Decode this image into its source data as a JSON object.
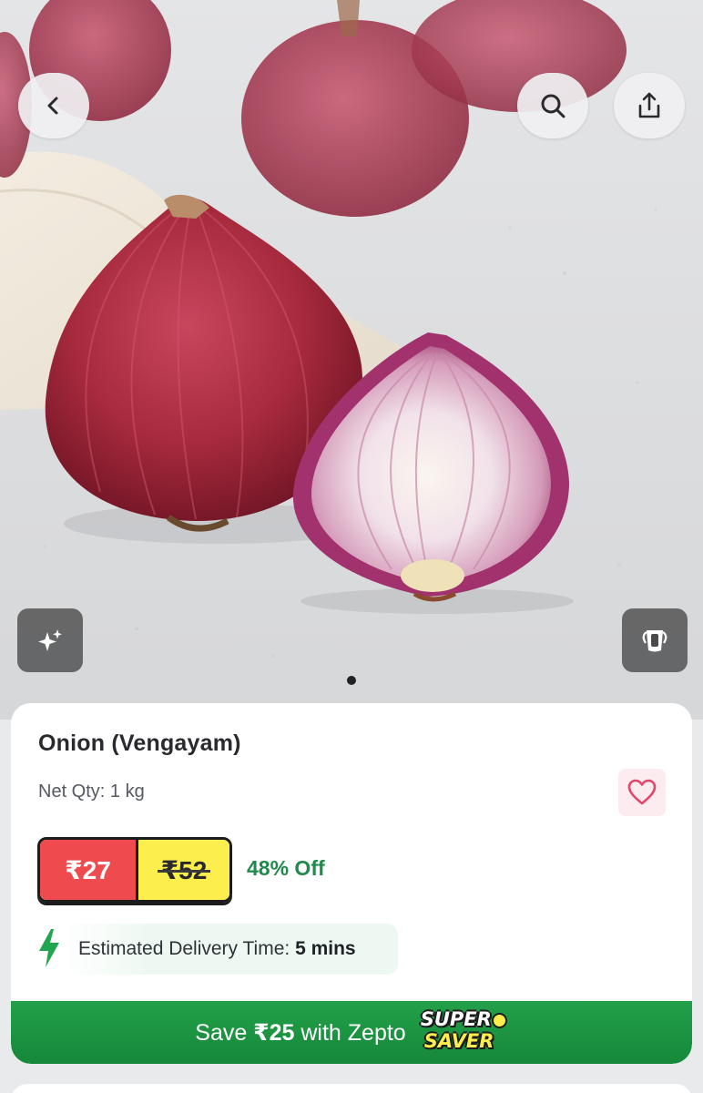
{
  "product": {
    "name": "Onion (Vengayam)",
    "net_qty": "Net Qty: 1 kg",
    "price": "₹27",
    "mrp": "₹52",
    "discount": "48% Off",
    "wishlisted": false
  },
  "delivery": {
    "label": "Estimated Delivery Time:",
    "value": "5 mins"
  },
  "saver": {
    "prefix": "Save",
    "amount": "₹25",
    "suffix": "with Zepto",
    "logo_line1": "SUPER",
    "logo_line2": "SAVER"
  },
  "gallery": {
    "current_image": 1,
    "total_images": 1
  },
  "icons": {
    "back": "chevron-left-icon",
    "search": "search-icon",
    "share": "share-icon",
    "ai": "sparkle-icon",
    "cup": "cup-icon",
    "wishlist": "heart-icon",
    "delivery": "lightning-icon"
  },
  "colors": {
    "price_bg": "#ef4b4f",
    "mrp_bg": "#fbee4d",
    "discount": "#1f8a4c",
    "saver_bar": "#1a9140",
    "heart": "#e0456b"
  }
}
